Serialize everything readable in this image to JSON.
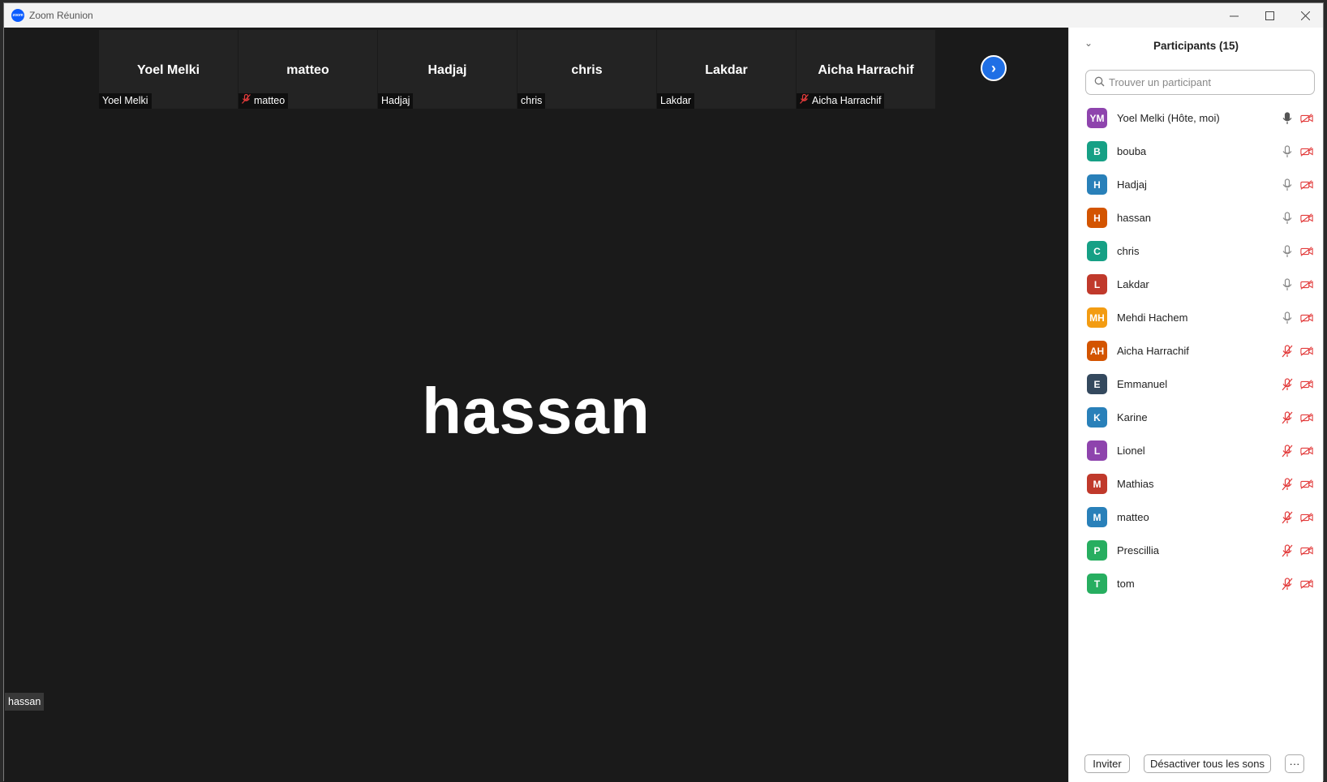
{
  "window": {
    "title": "Zoom Réunion"
  },
  "thumbnails": [
    {
      "name": "Yoel Melki",
      "label": "Yoel Melki",
      "muted": false
    },
    {
      "name": "matteo",
      "label": "matteo",
      "muted": true
    },
    {
      "name": "Hadjaj",
      "label": "Hadjaj",
      "muted": false
    },
    {
      "name": "chris",
      "label": "chris",
      "muted": false
    },
    {
      "name": "Lakdar",
      "label": "Lakdar",
      "muted": false
    },
    {
      "name": "Aicha Harrachif",
      "label": "Aicha Harrachif",
      "muted": true
    }
  ],
  "active_speaker": {
    "name": "hassan",
    "label": "hassan"
  },
  "panel": {
    "title": "Participants (15)",
    "search_placeholder": "Trouver un participant",
    "invite_label": "Inviter",
    "mute_all_label": "Désactiver tous les sons",
    "more_label": "···"
  },
  "participants": [
    {
      "initials": "YM",
      "name": "Yoel Melki (Hôte, moi)",
      "color": "#8e44ad",
      "mic": "on-dark"
    },
    {
      "initials": "B",
      "name": "bouba",
      "color": "#16a085",
      "mic": "on"
    },
    {
      "initials": "H",
      "name": "Hadjaj",
      "color": "#2980b9",
      "mic": "on"
    },
    {
      "initials": "H",
      "name": "hassan",
      "color": "#d35400",
      "mic": "on"
    },
    {
      "initials": "C",
      "name": "chris",
      "color": "#16a085",
      "mic": "on"
    },
    {
      "initials": "L",
      "name": "Lakdar",
      "color": "#c0392b",
      "mic": "on"
    },
    {
      "initials": "MH",
      "name": "Mehdi Hachem",
      "color": "#f39c12",
      "mic": "on"
    },
    {
      "initials": "AH",
      "name": "Aicha Harrachif",
      "color": "#d35400",
      "mic": "muted"
    },
    {
      "initials": "E",
      "name": "Emmanuel",
      "color": "#34495e",
      "mic": "muted"
    },
    {
      "initials": "K",
      "name": "Karine",
      "color": "#2980b9",
      "mic": "muted"
    },
    {
      "initials": "L",
      "name": "Lionel",
      "color": "#8e44ad",
      "mic": "muted"
    },
    {
      "initials": "M",
      "name": "Mathias",
      "color": "#c0392b",
      "mic": "muted"
    },
    {
      "initials": "M",
      "name": "matteo",
      "color": "#2980b9",
      "mic": "muted"
    },
    {
      "initials": "P",
      "name": "Prescillia",
      "color": "#27ae60",
      "mic": "muted"
    },
    {
      "initials": "T",
      "name": "tom",
      "color": "#27ae60",
      "mic": "muted"
    }
  ]
}
